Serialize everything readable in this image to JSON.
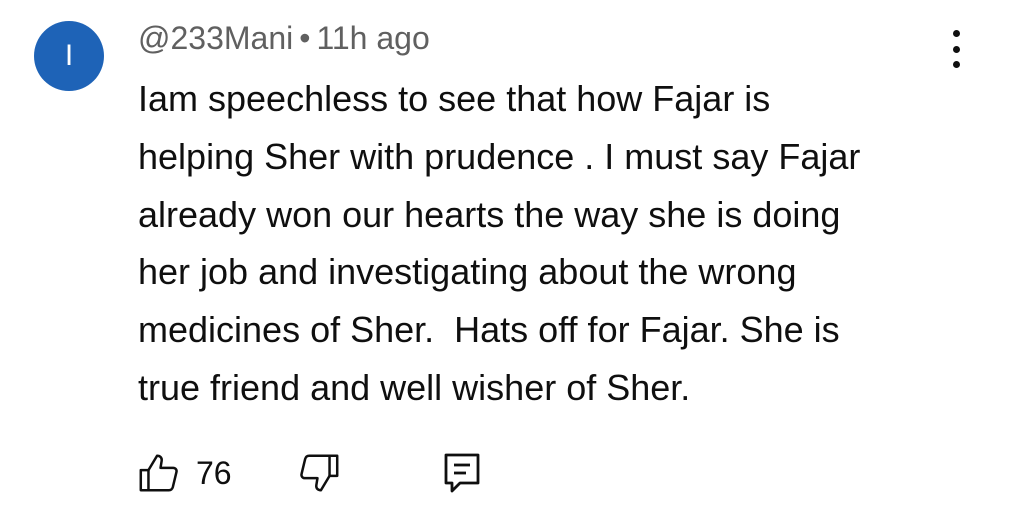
{
  "comment": {
    "avatar_letter": "I",
    "avatar_color": "#1e63b7",
    "author": "@233Mani",
    "separator": "•",
    "timestamp": "11h ago",
    "body_lines": [
      "Iam speechless to see that how Fajar is",
      "helping Sher with prudence . I must say Fajar",
      "already won our hearts the way she is doing",
      "her job and investigating about the wrong",
      "medicines of Sher.  Hats off for Fajar. She is",
      "true friend and well wisher of Sher."
    ],
    "like_count": "76",
    "icons": {
      "like": "thumbs-up-icon",
      "dislike": "thumbs-down-icon",
      "reply": "reply-comment-icon",
      "menu": "more-vertical-icon"
    }
  }
}
